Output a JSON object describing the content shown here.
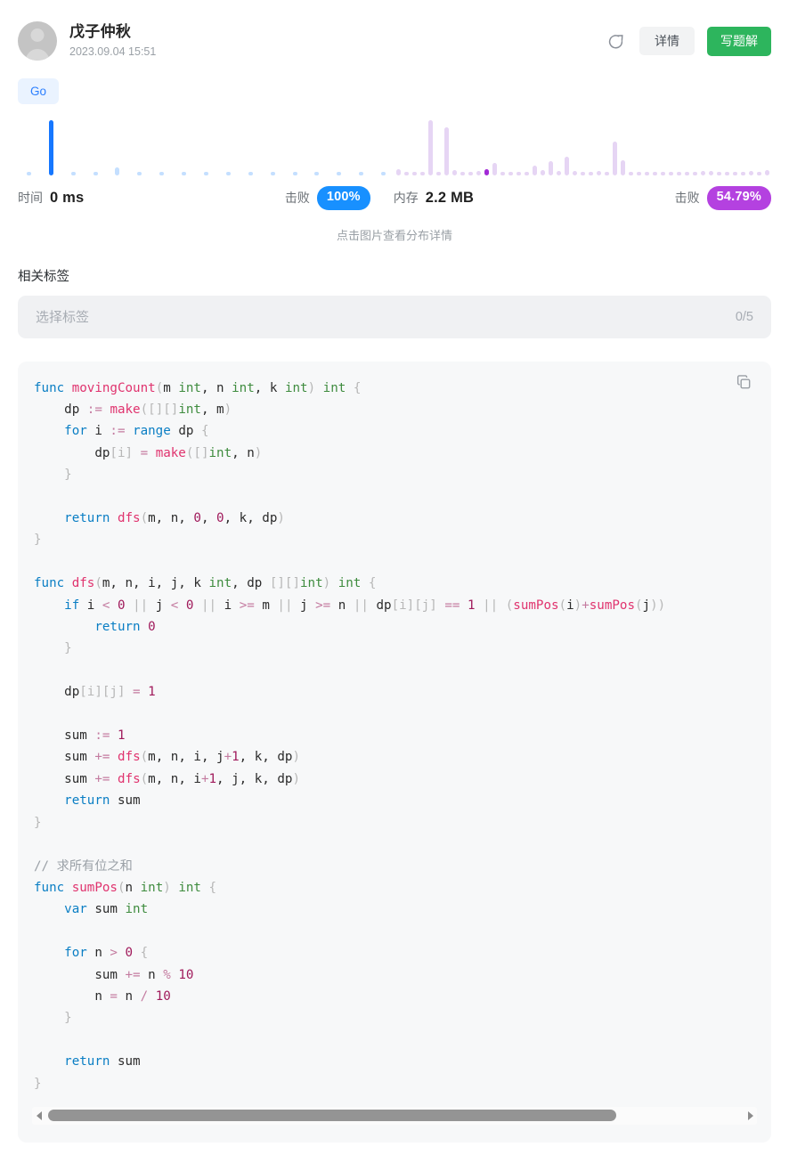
{
  "header": {
    "avatar_alt": "user-avatar",
    "username": "戊子仲秋",
    "timestamp": "2023.09.04 15:51",
    "share_icon": "share-external-icon",
    "detail_button": "详情",
    "write_solution_button": "写题解"
  },
  "language": {
    "tag": "Go"
  },
  "stats": {
    "time_label": "时间",
    "time_value": "0 ms",
    "time_beat_label": "击败",
    "time_beat_value": "100%",
    "memory_label": "内存",
    "memory_value": "2.2 MB",
    "memory_beat_label": "击败",
    "memory_beat_value": "54.79%",
    "hint": "点击图片查看分布详情",
    "colors": {
      "time_active": "#1677ff",
      "time_inactive": "#c4dfff",
      "memory_active": "#a229d6",
      "memory_inactive": "#e6d5f4",
      "badge_blue": "#1890ff",
      "badge_purple": "#b441e0"
    }
  },
  "chart_data": [
    {
      "type": "bar",
      "title": "时间分布",
      "name": "time-distribution",
      "xlabel": "",
      "ylabel": "",
      "grid": false,
      "ylim": [
        0,
        100
      ],
      "highlight_index": 1,
      "x": [
        0,
        1,
        2,
        3,
        4,
        5,
        6,
        7,
        8,
        9,
        10,
        11,
        12,
        13,
        14,
        15,
        16
      ],
      "values": [
        0,
        100,
        0,
        0,
        14,
        0,
        0,
        4,
        0,
        0,
        4,
        0,
        0,
        4,
        0,
        0,
        0
      ]
    },
    {
      "type": "bar",
      "title": "内存分布",
      "name": "memory-distribution",
      "xlabel": "",
      "ylabel": "",
      "grid": false,
      "ylim": [
        0,
        100
      ],
      "highlight_index": 11,
      "x": [
        0,
        1,
        2,
        3,
        4,
        5,
        6,
        7,
        8,
        9,
        10,
        11,
        12,
        13,
        14,
        15,
        16,
        17,
        18,
        19,
        20,
        21,
        22,
        23,
        24,
        25,
        26,
        27,
        28,
        29,
        30,
        31,
        32,
        33,
        34,
        35,
        36,
        37,
        38,
        39,
        40,
        41,
        42,
        43,
        44,
        45,
        46
      ],
      "values": [
        9,
        3,
        4,
        5,
        78,
        4,
        68,
        8,
        5,
        5,
        6,
        9,
        18,
        4,
        4,
        5,
        5,
        14,
        7,
        20,
        6,
        26,
        6,
        5,
        5,
        6,
        4,
        48,
        22,
        5,
        5,
        4,
        5,
        5,
        5,
        4,
        5,
        5,
        6,
        6,
        5,
        5,
        5,
        5,
        6,
        5,
        7
      ]
    }
  ],
  "tags": {
    "section_title": "相关标签",
    "placeholder": "选择标签",
    "counter": "0/5"
  },
  "code": {
    "language": "go",
    "copy_icon": "copy-icon",
    "lines": [
      [
        {
          "t": "func ",
          "c": "kw"
        },
        {
          "t": "movingCount",
          "c": "fn"
        },
        {
          "t": "(",
          "c": "pn"
        },
        {
          "t": "m ",
          "c": "pl"
        },
        {
          "t": "int",
          "c": "typ"
        },
        {
          "t": ", ",
          "c": "pl"
        },
        {
          "t": "n ",
          "c": "pl"
        },
        {
          "t": "int",
          "c": "typ"
        },
        {
          "t": ", ",
          "c": "pl"
        },
        {
          "t": "k ",
          "c": "pl"
        },
        {
          "t": "int",
          "c": "typ"
        },
        {
          "t": ")",
          "c": "pn"
        },
        {
          "t": " ",
          "c": "pl"
        },
        {
          "t": "int",
          "c": "typ"
        },
        {
          "t": " {",
          "c": "pn"
        }
      ],
      [
        {
          "t": "    dp ",
          "c": "pl"
        },
        {
          "t": ":=",
          "c": "op"
        },
        {
          "t": " ",
          "c": "pl"
        },
        {
          "t": "make",
          "c": "fn"
        },
        {
          "t": "(",
          "c": "pn"
        },
        {
          "t": "[][]",
          "c": "pn"
        },
        {
          "t": "int",
          "c": "typ"
        },
        {
          "t": ", ",
          "c": "pl"
        },
        {
          "t": "m",
          "c": "pl"
        },
        {
          "t": ")",
          "c": "pn"
        }
      ],
      [
        {
          "t": "    ",
          "c": "pl"
        },
        {
          "t": "for",
          "c": "kw"
        },
        {
          "t": " i ",
          "c": "pl"
        },
        {
          "t": ":=",
          "c": "op"
        },
        {
          "t": " ",
          "c": "pl"
        },
        {
          "t": "range",
          "c": "kw"
        },
        {
          "t": " dp ",
          "c": "pl"
        },
        {
          "t": "{",
          "c": "pn"
        }
      ],
      [
        {
          "t": "        dp",
          "c": "pl"
        },
        {
          "t": "[i]",
          "c": "pn"
        },
        {
          "t": " ",
          "c": "pl"
        },
        {
          "t": "=",
          "c": "op"
        },
        {
          "t": " ",
          "c": "pl"
        },
        {
          "t": "make",
          "c": "fn"
        },
        {
          "t": "(",
          "c": "pn"
        },
        {
          "t": "[]",
          "c": "pn"
        },
        {
          "t": "int",
          "c": "typ"
        },
        {
          "t": ", ",
          "c": "pl"
        },
        {
          "t": "n",
          "c": "pl"
        },
        {
          "t": ")",
          "c": "pn"
        }
      ],
      [
        {
          "t": "    }",
          "c": "pn"
        }
      ],
      [
        {
          "t": "",
          "c": "pl"
        }
      ],
      [
        {
          "t": "    ",
          "c": "pl"
        },
        {
          "t": "return",
          "c": "kw"
        },
        {
          "t": " ",
          "c": "pl"
        },
        {
          "t": "dfs",
          "c": "fn"
        },
        {
          "t": "(",
          "c": "pn"
        },
        {
          "t": "m, n, ",
          "c": "pl"
        },
        {
          "t": "0",
          "c": "num"
        },
        {
          "t": ", ",
          "c": "pl"
        },
        {
          "t": "0",
          "c": "num"
        },
        {
          "t": ", k, dp",
          "c": "pl"
        },
        {
          "t": ")",
          "c": "pn"
        }
      ],
      [
        {
          "t": "}",
          "c": "pn"
        }
      ],
      [
        {
          "t": "",
          "c": "pl"
        }
      ],
      [
        {
          "t": "func ",
          "c": "kw"
        },
        {
          "t": "dfs",
          "c": "fn"
        },
        {
          "t": "(",
          "c": "pn"
        },
        {
          "t": "m, n, i, j, k ",
          "c": "pl"
        },
        {
          "t": "int",
          "c": "typ"
        },
        {
          "t": ", dp ",
          "c": "pl"
        },
        {
          "t": "[][]",
          "c": "pn"
        },
        {
          "t": "int",
          "c": "typ"
        },
        {
          "t": ")",
          "c": "pn"
        },
        {
          "t": " ",
          "c": "pl"
        },
        {
          "t": "int",
          "c": "typ"
        },
        {
          "t": " {",
          "c": "pn"
        }
      ],
      [
        {
          "t": "    ",
          "c": "pl"
        },
        {
          "t": "if",
          "c": "kw"
        },
        {
          "t": " i ",
          "c": "pl"
        },
        {
          "t": "<",
          "c": "op"
        },
        {
          "t": " ",
          "c": "pl"
        },
        {
          "t": "0",
          "c": "num"
        },
        {
          "t": " ",
          "c": "pl"
        },
        {
          "t": "||",
          "c": "pn"
        },
        {
          "t": " j ",
          "c": "pl"
        },
        {
          "t": "<",
          "c": "op"
        },
        {
          "t": " ",
          "c": "pl"
        },
        {
          "t": "0",
          "c": "num"
        },
        {
          "t": " ",
          "c": "pl"
        },
        {
          "t": "||",
          "c": "pn"
        },
        {
          "t": " i ",
          "c": "pl"
        },
        {
          "t": ">=",
          "c": "op"
        },
        {
          "t": " m ",
          "c": "pl"
        },
        {
          "t": "||",
          "c": "pn"
        },
        {
          "t": " j ",
          "c": "pl"
        },
        {
          "t": ">=",
          "c": "op"
        },
        {
          "t": " n ",
          "c": "pl"
        },
        {
          "t": "||",
          "c": "pn"
        },
        {
          "t": " dp",
          "c": "pl"
        },
        {
          "t": "[i][j]",
          "c": "pn"
        },
        {
          "t": " ",
          "c": "pl"
        },
        {
          "t": "==",
          "c": "op"
        },
        {
          "t": " ",
          "c": "pl"
        },
        {
          "t": "1",
          "c": "num"
        },
        {
          "t": " ",
          "c": "pl"
        },
        {
          "t": "||",
          "c": "pn"
        },
        {
          "t": " ",
          "c": "pl"
        },
        {
          "t": "(",
          "c": "pn"
        },
        {
          "t": "sumPos",
          "c": "fn"
        },
        {
          "t": "(",
          "c": "pn"
        },
        {
          "t": "i",
          "c": "pl"
        },
        {
          "t": ")",
          "c": "pn"
        },
        {
          "t": "+",
          "c": "op"
        },
        {
          "t": "sumPos",
          "c": "fn"
        },
        {
          "t": "(",
          "c": "pn"
        },
        {
          "t": "j",
          "c": "pl"
        },
        {
          "t": "))",
          "c": "pn"
        }
      ],
      [
        {
          "t": "        ",
          "c": "pl"
        },
        {
          "t": "return",
          "c": "kw"
        },
        {
          "t": " ",
          "c": "pl"
        },
        {
          "t": "0",
          "c": "num"
        }
      ],
      [
        {
          "t": "    }",
          "c": "pn"
        }
      ],
      [
        {
          "t": "",
          "c": "pl"
        }
      ],
      [
        {
          "t": "    dp",
          "c": "pl"
        },
        {
          "t": "[i][j]",
          "c": "pn"
        },
        {
          "t": " ",
          "c": "pl"
        },
        {
          "t": "=",
          "c": "op"
        },
        {
          "t": " ",
          "c": "pl"
        },
        {
          "t": "1",
          "c": "num"
        }
      ],
      [
        {
          "t": "",
          "c": "pl"
        }
      ],
      [
        {
          "t": "    sum ",
          "c": "pl"
        },
        {
          "t": ":=",
          "c": "op"
        },
        {
          "t": " ",
          "c": "pl"
        },
        {
          "t": "1",
          "c": "num"
        }
      ],
      [
        {
          "t": "    sum ",
          "c": "pl"
        },
        {
          "t": "+=",
          "c": "op"
        },
        {
          "t": " ",
          "c": "pl"
        },
        {
          "t": "dfs",
          "c": "fn"
        },
        {
          "t": "(",
          "c": "pn"
        },
        {
          "t": "m, n, i, j",
          "c": "pl"
        },
        {
          "t": "+",
          "c": "op"
        },
        {
          "t": "1",
          "c": "num"
        },
        {
          "t": ", k, dp",
          "c": "pl"
        },
        {
          "t": ")",
          "c": "pn"
        }
      ],
      [
        {
          "t": "    sum ",
          "c": "pl"
        },
        {
          "t": "+=",
          "c": "op"
        },
        {
          "t": " ",
          "c": "pl"
        },
        {
          "t": "dfs",
          "c": "fn"
        },
        {
          "t": "(",
          "c": "pn"
        },
        {
          "t": "m, n, i",
          "c": "pl"
        },
        {
          "t": "+",
          "c": "op"
        },
        {
          "t": "1",
          "c": "num"
        },
        {
          "t": ", j, k, dp",
          "c": "pl"
        },
        {
          "t": ")",
          "c": "pn"
        }
      ],
      [
        {
          "t": "    ",
          "c": "pl"
        },
        {
          "t": "return",
          "c": "kw"
        },
        {
          "t": " sum",
          "c": "pl"
        }
      ],
      [
        {
          "t": "}",
          "c": "pn"
        }
      ],
      [
        {
          "t": "",
          "c": "pl"
        }
      ],
      [
        {
          "t": "// 求所有位之和",
          "c": "cm"
        }
      ],
      [
        {
          "t": "func ",
          "c": "kw"
        },
        {
          "t": "sumPos",
          "c": "fn"
        },
        {
          "t": "(",
          "c": "pn"
        },
        {
          "t": "n ",
          "c": "pl"
        },
        {
          "t": "int",
          "c": "typ"
        },
        {
          "t": ")",
          "c": "pn"
        },
        {
          "t": " ",
          "c": "pl"
        },
        {
          "t": "int",
          "c": "typ"
        },
        {
          "t": " {",
          "c": "pn"
        }
      ],
      [
        {
          "t": "    ",
          "c": "pl"
        },
        {
          "t": "var",
          "c": "kw"
        },
        {
          "t": " sum ",
          "c": "pl"
        },
        {
          "t": "int",
          "c": "typ"
        }
      ],
      [
        {
          "t": "",
          "c": "pl"
        }
      ],
      [
        {
          "t": "    ",
          "c": "pl"
        },
        {
          "t": "for",
          "c": "kw"
        },
        {
          "t": " n ",
          "c": "pl"
        },
        {
          "t": ">",
          "c": "op"
        },
        {
          "t": " ",
          "c": "pl"
        },
        {
          "t": "0",
          "c": "num"
        },
        {
          "t": " ",
          "c": "pl"
        },
        {
          "t": "{",
          "c": "pn"
        }
      ],
      [
        {
          "t": "        sum ",
          "c": "pl"
        },
        {
          "t": "+=",
          "c": "op"
        },
        {
          "t": " n ",
          "c": "pl"
        },
        {
          "t": "%",
          "c": "op"
        },
        {
          "t": " ",
          "c": "pl"
        },
        {
          "t": "10",
          "c": "num"
        }
      ],
      [
        {
          "t": "        n ",
          "c": "pl"
        },
        {
          "t": "=",
          "c": "op"
        },
        {
          "t": " n ",
          "c": "pl"
        },
        {
          "t": "/",
          "c": "op"
        },
        {
          "t": " ",
          "c": "pl"
        },
        {
          "t": "10",
          "c": "num"
        }
      ],
      [
        {
          "t": "    }",
          "c": "pn"
        }
      ],
      [
        {
          "t": "",
          "c": "pl"
        }
      ],
      [
        {
          "t": "    ",
          "c": "pl"
        },
        {
          "t": "return",
          "c": "kw"
        },
        {
          "t": " sum",
          "c": "pl"
        }
      ],
      [
        {
          "t": "}",
          "c": "pn"
        }
      ]
    ]
  },
  "scrollbar": {
    "left_arrow": "chevron-left-icon",
    "right_arrow": "chevron-right-icon",
    "thumb_percent": 82
  }
}
